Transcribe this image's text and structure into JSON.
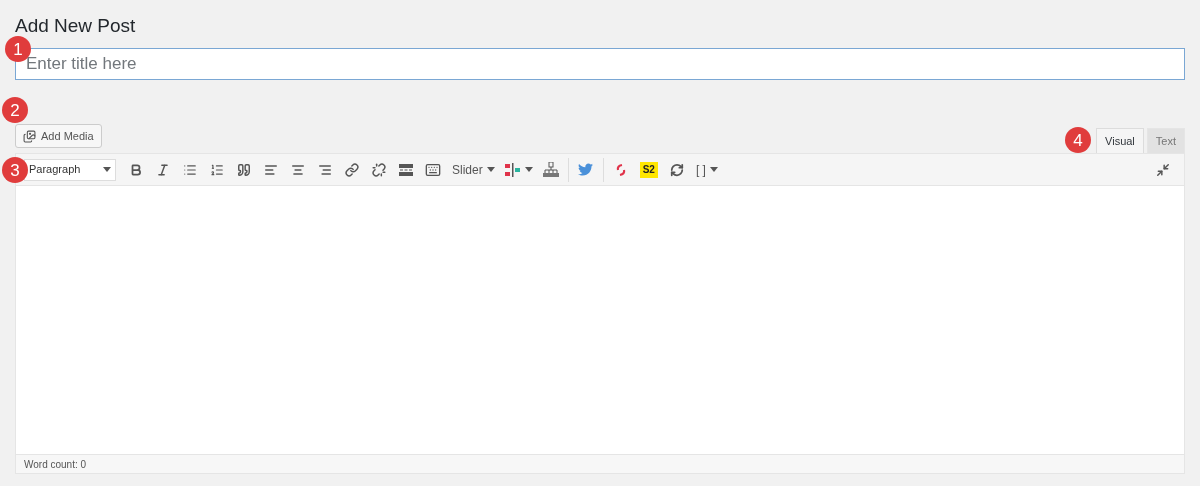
{
  "heading": "Add New Post",
  "title_field": {
    "placeholder": "Enter title here"
  },
  "add_media": "Add Media",
  "editor_tabs": [
    {
      "label": "Visual",
      "selected": true
    },
    {
      "label": "Text",
      "selected": false
    }
  ],
  "toolbar": {
    "format_select": "Paragraph",
    "slider_menu": "Slider",
    "s2_badge": "S2",
    "shortcode_menu": "[ ]"
  },
  "status_bar": "Word count: 0",
  "markers": [
    "1",
    "2",
    "3",
    "4"
  ]
}
